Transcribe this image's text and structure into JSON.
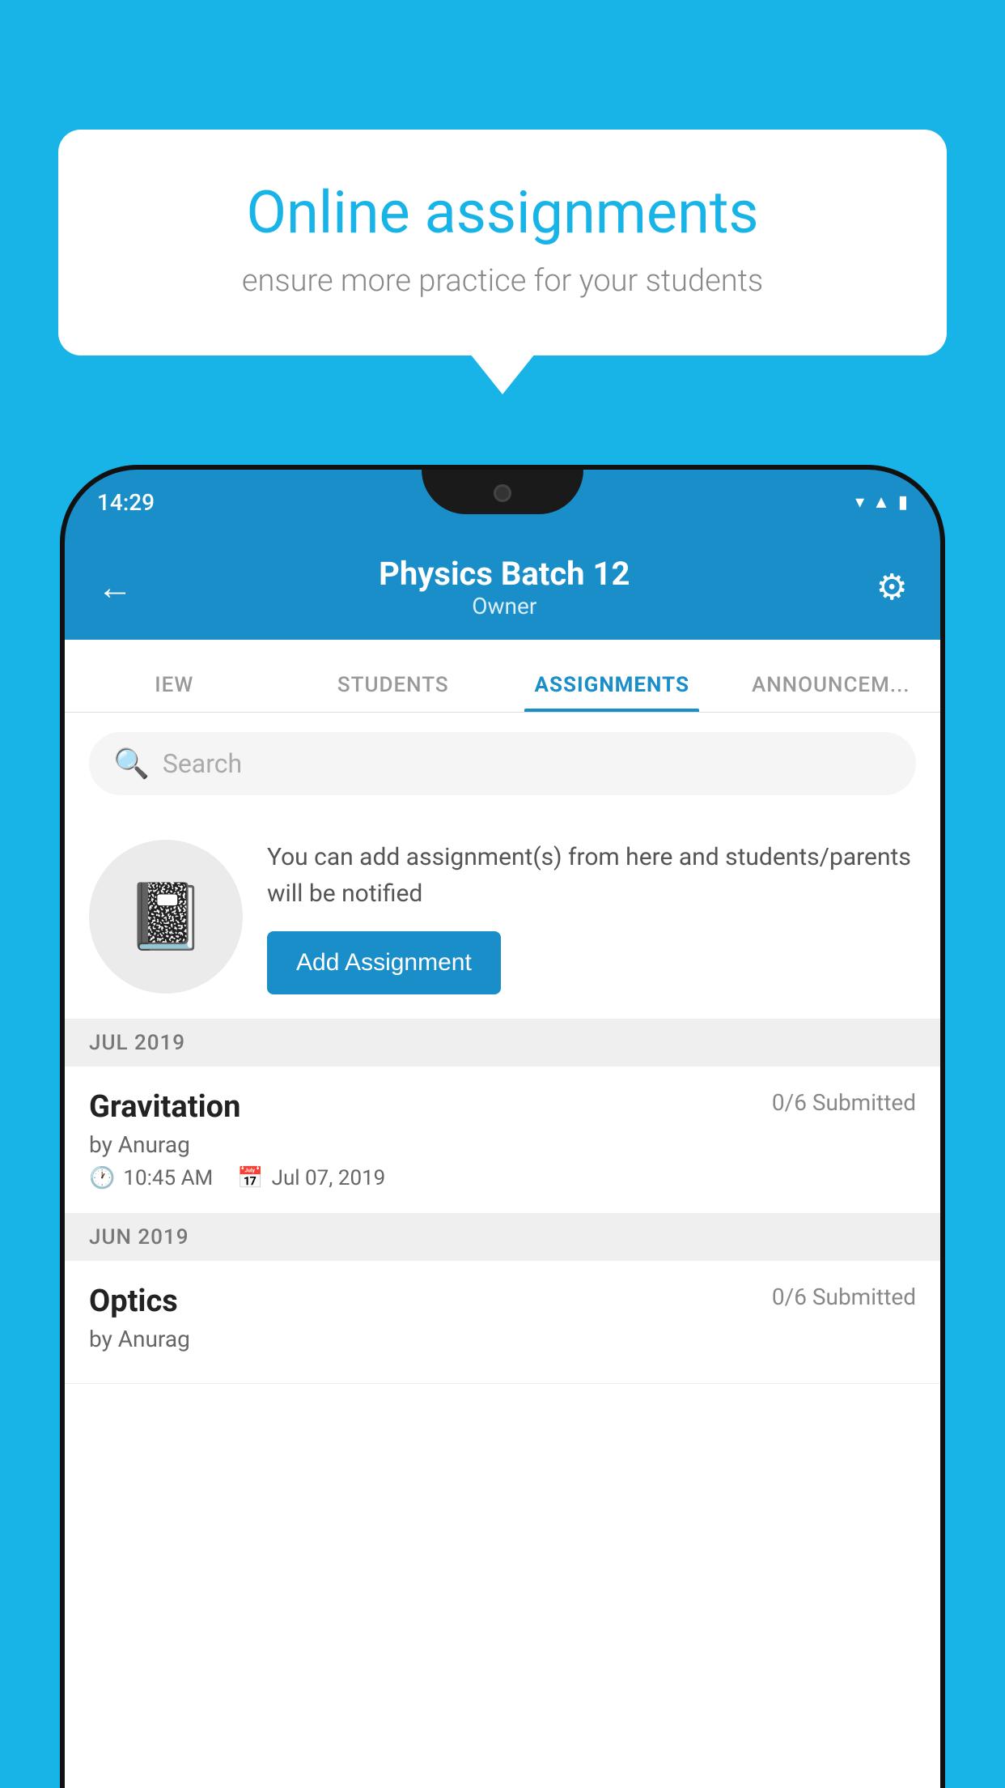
{
  "background_color": "#18b4e8",
  "bubble": {
    "title": "Online assignments",
    "subtitle": "ensure more practice for your students"
  },
  "phone": {
    "status_bar": {
      "time": "14:29",
      "icons": [
        "wifi",
        "signal",
        "battery"
      ]
    },
    "app_header": {
      "back_label": "←",
      "title": "Physics Batch 12",
      "subtitle": "Owner",
      "settings_icon": "⚙"
    },
    "tabs": [
      {
        "label": "IEW",
        "active": false
      },
      {
        "label": "STUDENTS",
        "active": false
      },
      {
        "label": "ASSIGNMENTS",
        "active": true
      },
      {
        "label": "ANNOUNCEM...",
        "active": false
      }
    ],
    "search": {
      "placeholder": "Search"
    },
    "promo": {
      "text": "You can add assignment(s) from here and students/parents will be notified",
      "button_label": "Add Assignment"
    },
    "sections": [
      {
        "month": "JUL 2019",
        "assignments": [
          {
            "name": "Gravitation",
            "submitted": "0/6 Submitted",
            "by": "by Anurag",
            "time": "10:45 AM",
            "date": "Jul 07, 2019"
          }
        ]
      },
      {
        "month": "JUN 2019",
        "assignments": [
          {
            "name": "Optics",
            "submitted": "0/6 Submitted",
            "by": "by Anurag",
            "time": "",
            "date": ""
          }
        ]
      }
    ]
  }
}
